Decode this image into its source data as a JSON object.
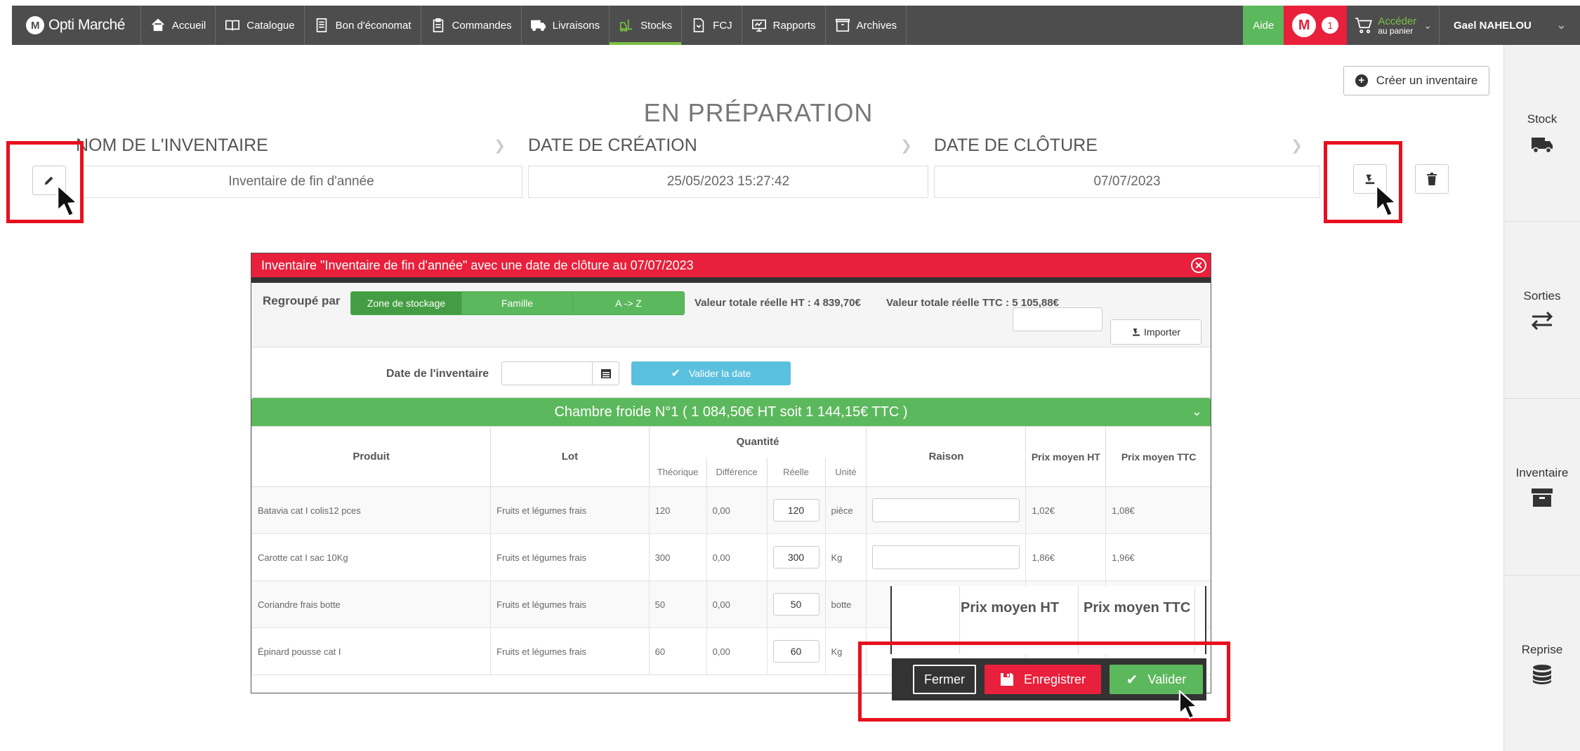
{
  "nav": {
    "brand": "Opti Marché",
    "items": [
      {
        "label": "Accueil",
        "icon": "home-icon"
      },
      {
        "label": "Catalogue",
        "icon": "book-icon"
      },
      {
        "label": "Bon d'économat",
        "icon": "document-icon"
      },
      {
        "label": "Commandes",
        "icon": "clipboard-icon"
      },
      {
        "label": "Livraisons",
        "icon": "truck-icon"
      },
      {
        "label": "Stocks",
        "icon": "forklift-icon",
        "active": true
      },
      {
        "label": "FCJ",
        "icon": "file-icon"
      },
      {
        "label": "Rapports",
        "icon": "monitor-icon"
      },
      {
        "label": "Archives",
        "icon": "archive-icon"
      }
    ],
    "aide": "Aide",
    "notif_count": "1",
    "cart_line1": "Accéder",
    "cart_line2": "au panier",
    "user": "Gael NAHELOU"
  },
  "sidebar": [
    "Stock",
    "Sorties",
    "Inventaire",
    "Reprise"
  ],
  "page": {
    "create_label": "Créer un inventaire",
    "status": "EN PRÉPARATION",
    "col_name": "NOM DE L'INVENTAIRE",
    "col_created": "DATE DE CRÉATION",
    "col_closing": "DATE DE CLÔTURE",
    "name_value": "Inventaire de fin d'année",
    "created_value": "25/05/2023 15:27:42",
    "closing_value": "07/07/2023"
  },
  "modal": {
    "title": "Inventaire \"Inventaire de fin d'année\" avec une date de clôture au 07/07/2023",
    "group_label": "Regroupé par",
    "group_options": [
      "Zone de stockage",
      "Famille",
      "A -> Z"
    ],
    "total_ht": "Valeur totale réelle HT : 4 839,70€",
    "total_ttc": "Valeur totale réelle TTC : 5 105,88€",
    "import_label": "Importer",
    "date_label": "Date de l'inventaire",
    "validate_date": "Valider la date",
    "zone": "Chambre froide N°1 ( 1 084,50€ HT soit 1 144,15€ TTC )",
    "headers": {
      "produit": "Produit",
      "lot": "Lot",
      "quantite": "Quantité",
      "theorique": "Théorique",
      "difference": "Différence",
      "reelle": "Réelle",
      "unite": "Unité",
      "raison": "Raison",
      "pm_ht": "Prix moyen HT",
      "pm_ttc": "Prix moyen TTC"
    },
    "rows": [
      {
        "produit": "Batavia cat I colis12 pces",
        "lot": "Fruits et légumes frais",
        "theo": "120",
        "diff": "0,00",
        "reel": "120",
        "unite": "pièce",
        "ht": "1,02€",
        "ttc": "1,08€"
      },
      {
        "produit": "Carotte cat I sac 10Kg",
        "lot": "Fruits et légumes frais",
        "theo": "300",
        "diff": "0,00",
        "reel": "300",
        "unite": "Kg",
        "ht": "1,86€",
        "ttc": "1,96€"
      },
      {
        "produit": "Coriandre frais botte",
        "lot": "Fruits et légumes frais",
        "theo": "50",
        "diff": "0,00",
        "reel": "50",
        "unite": "botte",
        "ht": "",
        "ttc": ""
      },
      {
        "produit": "Épinard pousse cat I",
        "lot": "Fruits et légumes frais",
        "theo": "60",
        "diff": "0,00",
        "reel": "60",
        "unite": "Kg",
        "ht": "",
        "ttc": ""
      }
    ],
    "float_ht": "Prix moyen HT",
    "float_ttc": "Prix moyen TTC",
    "btn_fermer": "Fermer",
    "btn_enregistrer": "Enregistrer",
    "btn_valider": "Valider"
  }
}
